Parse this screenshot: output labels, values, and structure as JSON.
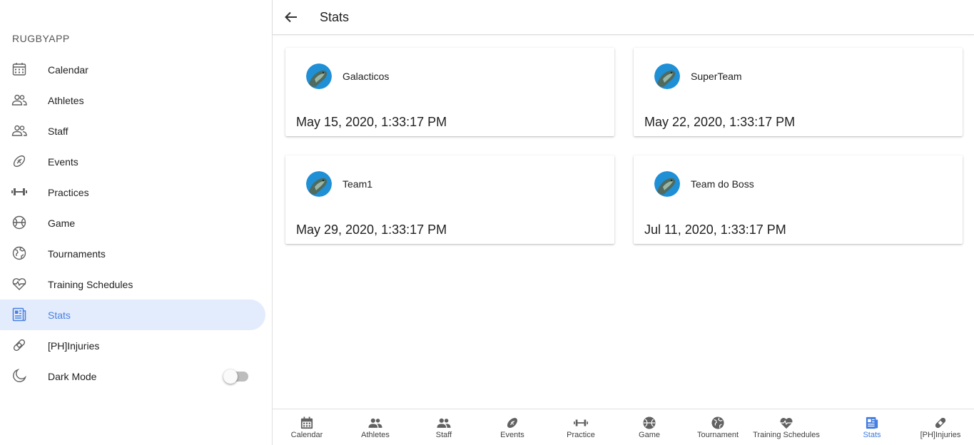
{
  "sidebar": {
    "app_name": "RUGBYAPP",
    "items": [
      {
        "label": "Calendar",
        "icon": "calendar-icon"
      },
      {
        "label": "Athletes",
        "icon": "people-icon"
      },
      {
        "label": "Staff",
        "icon": "people-icon"
      },
      {
        "label": "Events",
        "icon": "football-icon"
      },
      {
        "label": "Practices",
        "icon": "dumbbell-icon"
      },
      {
        "label": "Game",
        "icon": "ball-icon"
      },
      {
        "label": "Tournaments",
        "icon": "globe-icon"
      },
      {
        "label": "Training Schedules",
        "icon": "heart-pulse-icon"
      },
      {
        "label": "Stats",
        "icon": "newspaper-icon",
        "active": true
      },
      {
        "label": "[PH]Injuries",
        "icon": "bandage-icon"
      }
    ],
    "dark_mode": {
      "label": "Dark Mode",
      "icon": "moon-icon",
      "enabled": false
    }
  },
  "topbar": {
    "title": "Stats",
    "back_icon": "arrow-back-icon"
  },
  "cards": [
    {
      "team": "Galacticos",
      "date": "May 15, 2020, 1:33:17 PM"
    },
    {
      "team": "SuperTeam",
      "date": "May 22, 2020, 1:33:17 PM"
    },
    {
      "team": "Team1",
      "date": "May 29, 2020, 1:33:17 PM"
    },
    {
      "team": "Team do Boss",
      "date": "Jul 11, 2020, 1:33:17 PM"
    }
  ],
  "bottom_nav": [
    {
      "label": "Calendar",
      "icon": "calendar-icon"
    },
    {
      "label": "Athletes",
      "icon": "people-icon"
    },
    {
      "label": "Staff",
      "icon": "people-icon"
    },
    {
      "label": "Events",
      "icon": "football-icon"
    },
    {
      "label": "Practice",
      "icon": "dumbbell-icon"
    },
    {
      "label": "Game",
      "icon": "ball-icon"
    },
    {
      "label": "Tournament",
      "icon": "globe-icon"
    },
    {
      "label": "Training Schedules",
      "icon": "heart-pulse-icon"
    },
    {
      "label": "Stats",
      "icon": "newspaper-icon",
      "active": true
    },
    {
      "label": "[PH]Injuries",
      "icon": "bandage-icon"
    }
  ],
  "colors": {
    "accent": "#4a7fe0",
    "active_bg": "#e3ecfc"
  }
}
